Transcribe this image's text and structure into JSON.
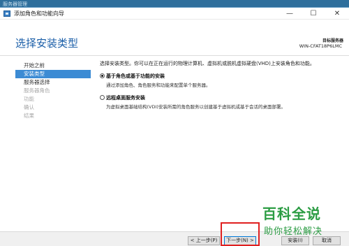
{
  "background": {
    "text": "服务器管理"
  },
  "window": {
    "title": "添加角色和功能向导",
    "controls": {
      "minimize": "—",
      "maximize": "☐",
      "close": "✕"
    }
  },
  "header": {
    "page_title": "选择安装类型",
    "target_label": "目标服务器",
    "target_value": "WIN-CFAT18P6LMC"
  },
  "sidebar": {
    "items": [
      {
        "label": "开始之前",
        "state": "normal"
      },
      {
        "label": "安装类型",
        "state": "active"
      },
      {
        "label": "服务器选择",
        "state": "normal"
      },
      {
        "label": "服务器角色",
        "state": "disabled"
      },
      {
        "label": "功能",
        "state": "disabled"
      },
      {
        "label": "确认",
        "state": "disabled"
      },
      {
        "label": "结果",
        "state": "disabled"
      }
    ]
  },
  "content": {
    "intro": "选择安装类型。你可以在正在运行的物理计算机、虚拟机或脱机虚拟硬盘(VHD)上安装角色和功能。",
    "options": [
      {
        "title": "基于角色或基于功能的安装",
        "desc": "通过添加角色、角色服务和功能来配置单个服务器。",
        "selected": true
      },
      {
        "title": "远程桌面服务安装",
        "desc": "为虚拟桌面基础结构(VDI)安装所需的角色服务以创建基于虚拟机或基于会话的桌面部署。",
        "selected": false
      }
    ]
  },
  "footer": {
    "prev": "< 上一步(P)",
    "next": "下一步(N) >",
    "install": "安装(I)",
    "cancel": "取消"
  },
  "watermark": {
    "main": "百科全说",
    "sub": "助你轻松解决"
  },
  "colors": {
    "accent": "#3c8bd4",
    "title_blue": "#1a5ea8",
    "highlight_red": "#e02020",
    "watermark_green": "#2b9c43"
  }
}
